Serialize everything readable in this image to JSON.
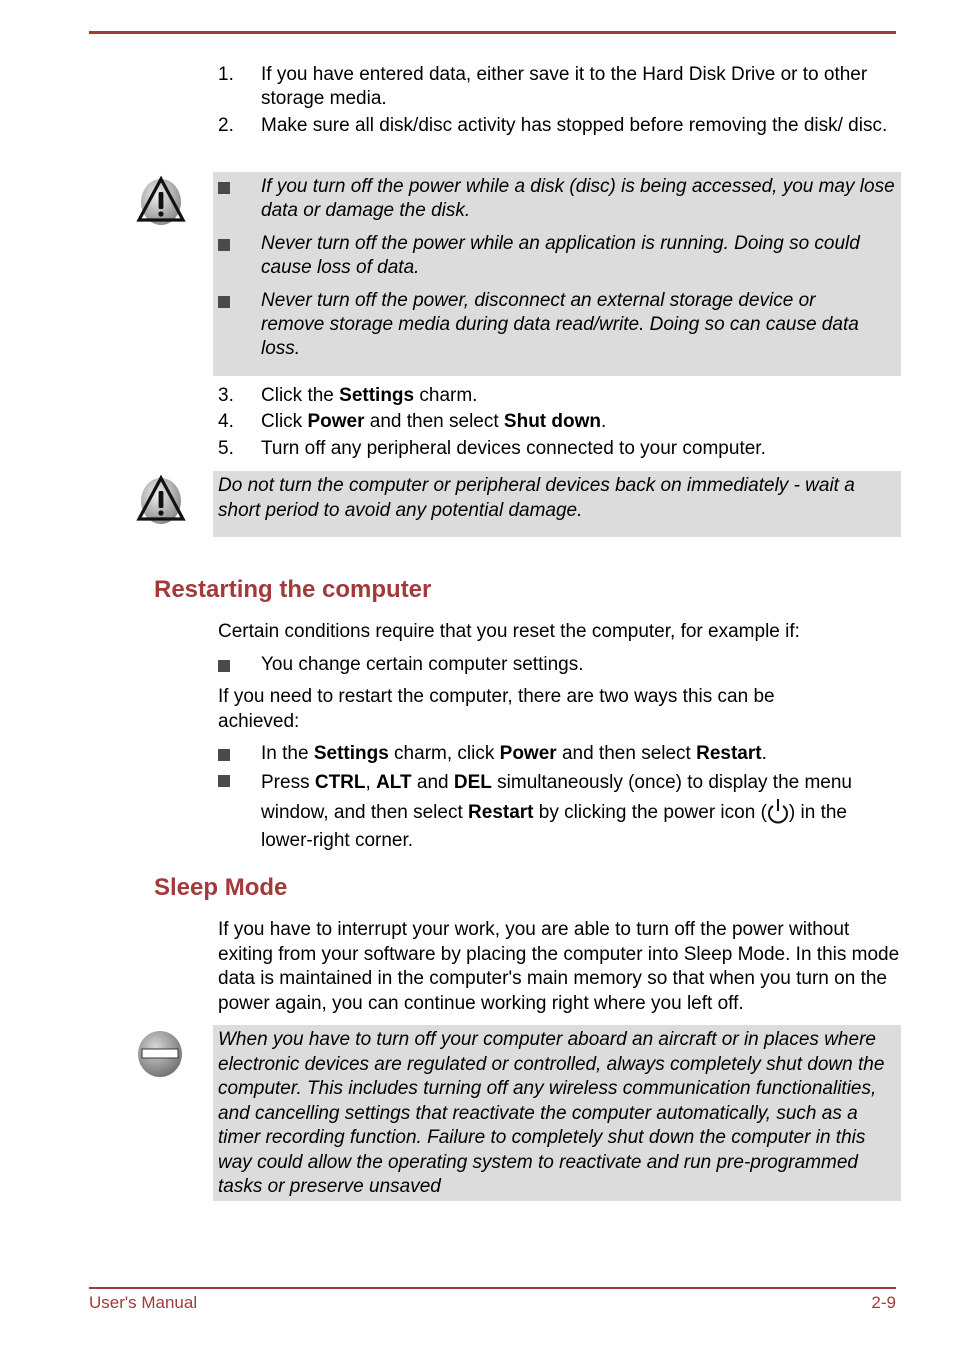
{
  "steps_top": [
    {
      "num": "1.",
      "text": "If you have entered data, either save it to the Hard Disk Drive or to other storage media."
    },
    {
      "num": "2.",
      "text": "Make sure all disk/disc activity has stopped before removing the disk/ disc."
    }
  ],
  "caution1": {
    "icon": "warning-triangle-icon",
    "items": [
      "If you turn off the power while a disk (disc) is being accessed, you may lose data or damage the disk.",
      "Never turn off the power while an application is running. Doing so could cause loss of data.",
      "Never turn off the power, disconnect an external storage device or remove storage media during data read/write. Doing so can cause data loss."
    ]
  },
  "steps_mid": [
    {
      "num": "3.",
      "pre": "Click the ",
      "b1": "Settings",
      "mid": " charm.",
      "b2": "",
      "post": ""
    },
    {
      "num": "4.",
      "pre": "Click ",
      "b1": "Power",
      "mid": " and then select ",
      "b2": "Shut down",
      "post": "."
    },
    {
      "num": "5.",
      "pre": "Turn off any peripheral devices connected to your computer.",
      "b1": "",
      "mid": "",
      "b2": "",
      "post": ""
    }
  ],
  "caution2": {
    "icon": "warning-triangle-icon",
    "text": "Do not turn the computer or peripheral devices back on immediately - wait a short period to avoid any potential damage."
  },
  "restart": {
    "heading": "Restarting the computer",
    "intro": "Certain conditions require that you reset the computer, for example if:",
    "condition": "You change certain computer settings.",
    "ways_intro": "If you need to restart the computer, there are two ways this can be achieved:",
    "way1": {
      "t1": "In the ",
      "b1": "Settings",
      "t2": " charm, click ",
      "b2": "Power",
      "t3": " and then select ",
      "b3": "Restart",
      "t4": "."
    },
    "way2": {
      "t1": "Press ",
      "b1": "CTRL",
      "t2": ", ",
      "b2": "ALT",
      "t3": " and ",
      "b3": "DEL",
      "t4": " simultaneously (once) to display the menu window, and then select ",
      "b4": "Restart",
      "t5": " by clicking the power icon (",
      "icon": "power-icon",
      "t6": ") in the lower-right corner."
    }
  },
  "sleep": {
    "heading": "Sleep Mode",
    "para": "If you have to interrupt your work, you are able to turn off the power without exiting from your software by placing the computer into Sleep Mode. In this mode data is maintained in the computer's main memory so that when you turn on the power again, you can continue working right where you left off.",
    "note_icon": "prohibited-icon",
    "note": "When you have to turn off your computer aboard an aircraft or in places where electronic devices are regulated or controlled, always completely shut down the computer. This includes turning off any wireless communication functionalities, and cancelling settings that reactivate the computer automatically, such as a timer recording function. Failure to completely shut down the computer in this way could allow the operating system to reactivate and run pre-programmed tasks or preserve unsaved"
  },
  "footer": {
    "left": "User's Manual",
    "right": "2-9"
  },
  "colors": {
    "accent": "#a33a3a",
    "note_bg": "#dcdcdc"
  }
}
